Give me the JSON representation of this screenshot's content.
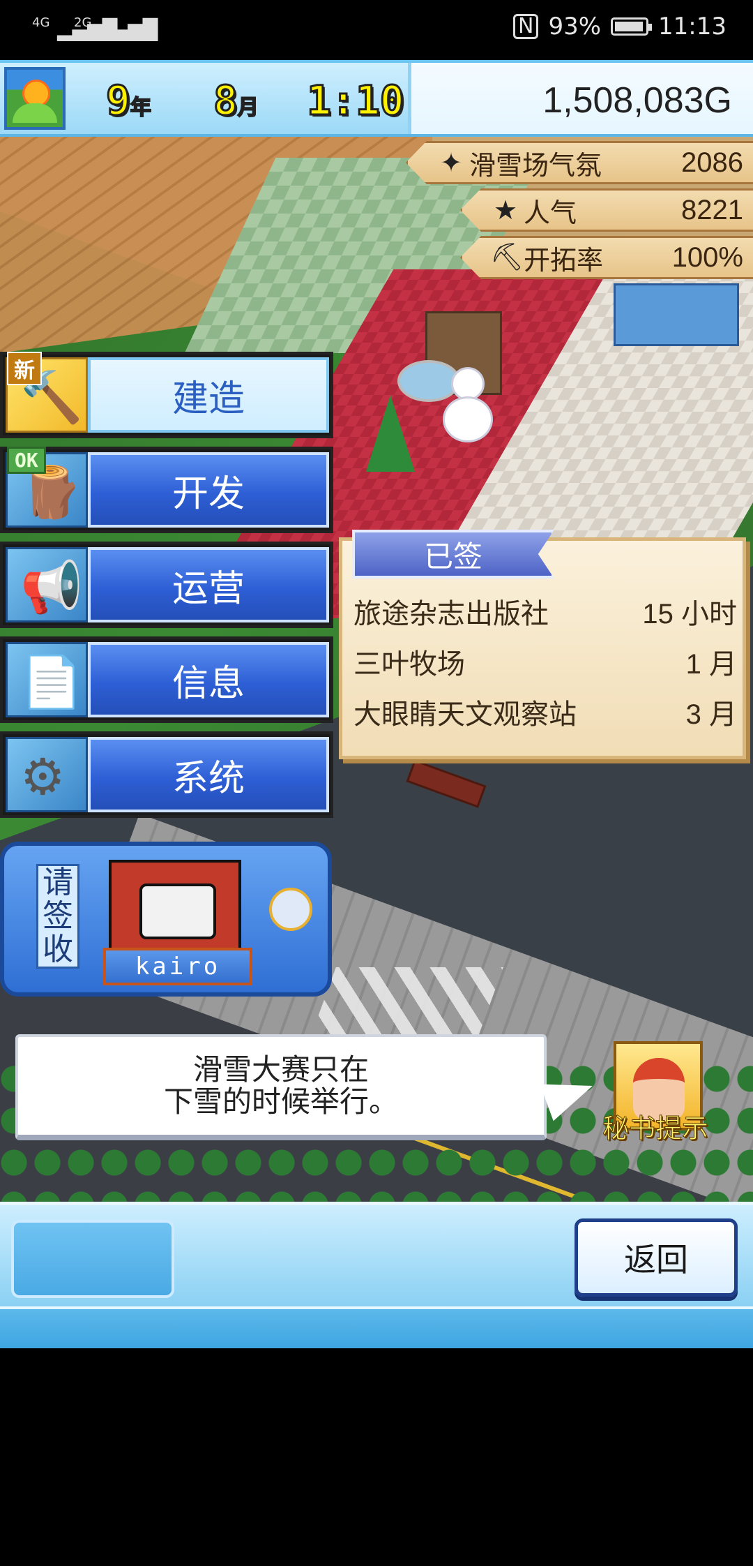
{
  "status_bar": {
    "signal1": "4G",
    "signal2": "2G",
    "battery": "93%",
    "time": "11:13"
  },
  "hud": {
    "year": "9",
    "year_unit": "年",
    "month": "8",
    "month_unit": "月",
    "clock": "1:10",
    "money": "1,508,083G"
  },
  "stats": [
    {
      "icon": "sparkle-icon",
      "glyph": "✦",
      "label": "滑雪场气氛",
      "value": "2086"
    },
    {
      "icon": "star-icon",
      "glyph": "★",
      "label": "人气",
      "value": "8221"
    },
    {
      "icon": "pickaxe-icon",
      "glyph": "⛏",
      "label": "开拓率",
      "value": "100%"
    }
  ],
  "menu": [
    {
      "label": "建造",
      "badge": "新",
      "glyph": "🔨",
      "active": true
    },
    {
      "label": "开发",
      "badge": "OK",
      "glyph": "🪵",
      "active": false
    },
    {
      "label": "运营",
      "badge": "",
      "glyph": "📢",
      "active": false
    },
    {
      "label": "信息",
      "badge": "",
      "glyph": "📄",
      "active": false
    },
    {
      "label": "系统",
      "badge": "",
      "glyph": "⚙",
      "active": false
    }
  ],
  "contracts": {
    "tab": "已签",
    "rows": [
      {
        "name": "旅途杂志出版社",
        "duration": "15 小时"
      },
      {
        "name": "三叶牧场",
        "duration": "1 月"
      },
      {
        "name": "大眼睛天文观察站",
        "duration": "3 月"
      }
    ]
  },
  "mail": {
    "sign": [
      "请",
      "签",
      "收"
    ],
    "plate": "kairo"
  },
  "tip": {
    "line1": "滑雪大赛只在",
    "line2": "下雪的时候举行。"
  },
  "secretary": {
    "label": "秘书提示"
  },
  "bottom": {
    "back": "返回"
  },
  "colors": {
    "hud_bg": "#9cd9f7",
    "menu_blue": "#2e5fd6",
    "stat_ribbon": "#e7c489",
    "contract_bg": "#f1ddb6"
  }
}
